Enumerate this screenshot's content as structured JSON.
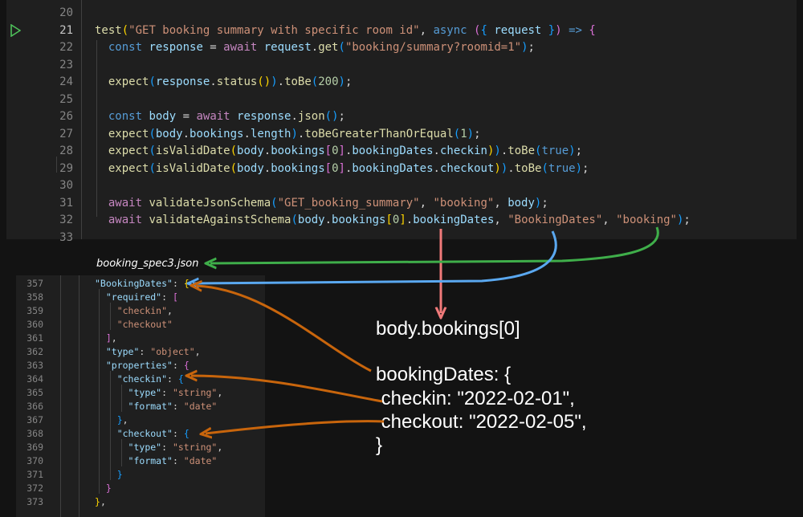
{
  "top_editor": {
    "lines": [
      {
        "n": "20",
        "tokens": []
      },
      {
        "n": "21",
        "tokens": [
          [
            "fn",
            "test"
          ],
          [
            "br1",
            "("
          ],
          [
            "str",
            "\"GET booking summary with specific room id\""
          ],
          [
            "pun",
            ", "
          ],
          [
            "kw",
            "async"
          ],
          [
            "pun",
            " "
          ],
          [
            "br2",
            "("
          ],
          [
            "br3",
            "{"
          ],
          [
            "var",
            " request "
          ],
          [
            "br3",
            "}"
          ],
          [
            "br2",
            ")"
          ],
          [
            "kw",
            " =>"
          ],
          [
            "pun",
            " "
          ],
          [
            "br2",
            "{"
          ]
        ]
      },
      {
        "n": "22",
        "tokens": [
          [
            "pun",
            "  "
          ],
          [
            "kw",
            "const"
          ],
          [
            "var",
            " response"
          ],
          [
            "pun",
            " = "
          ],
          [
            "kw2",
            "await"
          ],
          [
            "var",
            " request"
          ],
          [
            "pun",
            "."
          ],
          [
            "fn",
            "get"
          ],
          [
            "br3",
            "("
          ],
          [
            "str",
            "\"booking/summary?roomid=1\""
          ],
          [
            "br3",
            ")"
          ],
          [
            "pun",
            ";"
          ]
        ]
      },
      {
        "n": "23",
        "tokens": []
      },
      {
        "n": "24",
        "tokens": [
          [
            "pun",
            "  "
          ],
          [
            "fn",
            "expect"
          ],
          [
            "br3",
            "("
          ],
          [
            "var",
            "response"
          ],
          [
            "pun",
            "."
          ],
          [
            "fn",
            "status"
          ],
          [
            "br1",
            "()"
          ],
          [
            "br3",
            ")"
          ],
          [
            "pun",
            "."
          ],
          [
            "fn",
            "toBe"
          ],
          [
            "br3",
            "("
          ],
          [
            "num",
            "200"
          ],
          [
            "br3",
            ")"
          ],
          [
            "pun",
            ";"
          ]
        ]
      },
      {
        "n": "25",
        "tokens": []
      },
      {
        "n": "26",
        "tokens": [
          [
            "pun",
            "  "
          ],
          [
            "kw",
            "const"
          ],
          [
            "var",
            " body"
          ],
          [
            "pun",
            " = "
          ],
          [
            "kw2",
            "await"
          ],
          [
            "var",
            " response"
          ],
          [
            "pun",
            "."
          ],
          [
            "fn",
            "json"
          ],
          [
            "br3",
            "()"
          ],
          [
            "pun",
            ";"
          ]
        ]
      },
      {
        "n": "27",
        "tokens": [
          [
            "pun",
            "  "
          ],
          [
            "fn",
            "expect"
          ],
          [
            "br3",
            "("
          ],
          [
            "var",
            "body"
          ],
          [
            "pun",
            "."
          ],
          [
            "var",
            "bookings"
          ],
          [
            "pun",
            "."
          ],
          [
            "var",
            "length"
          ],
          [
            "br3",
            ")"
          ],
          [
            "pun",
            "."
          ],
          [
            "fn",
            "toBeGreaterThanOrEqual"
          ],
          [
            "br3",
            "("
          ],
          [
            "num",
            "1"
          ],
          [
            "br3",
            ")"
          ],
          [
            "pun",
            ";"
          ]
        ]
      },
      {
        "n": "28",
        "tokens": [
          [
            "pun",
            "  "
          ],
          [
            "fn",
            "expect"
          ],
          [
            "br3",
            "("
          ],
          [
            "fn",
            "isValidDate"
          ],
          [
            "br1",
            "("
          ],
          [
            "var",
            "body"
          ],
          [
            "pun",
            "."
          ],
          [
            "var",
            "bookings"
          ],
          [
            "br2",
            "["
          ],
          [
            "num",
            "0"
          ],
          [
            "br2",
            "]"
          ],
          [
            "pun",
            "."
          ],
          [
            "var",
            "bookingDates"
          ],
          [
            "pun",
            "."
          ],
          [
            "var",
            "checkin"
          ],
          [
            "br1",
            ")"
          ],
          [
            "br3",
            ")"
          ],
          [
            "pun",
            "."
          ],
          [
            "fn",
            "toBe"
          ],
          [
            "br3",
            "("
          ],
          [
            "kw",
            "true"
          ],
          [
            "br3",
            ")"
          ],
          [
            "pun",
            ";"
          ]
        ]
      },
      {
        "n": "29",
        "tokens": [
          [
            "pun",
            "  "
          ],
          [
            "fn",
            "expect"
          ],
          [
            "br3",
            "("
          ],
          [
            "fn",
            "isValidDate"
          ],
          [
            "br1",
            "("
          ],
          [
            "var",
            "body"
          ],
          [
            "pun",
            "."
          ],
          [
            "var",
            "bookings"
          ],
          [
            "br2",
            "["
          ],
          [
            "num",
            "0"
          ],
          [
            "br2",
            "]"
          ],
          [
            "pun",
            "."
          ],
          [
            "var",
            "bookingDates"
          ],
          [
            "pun",
            "."
          ],
          [
            "var",
            "checkout"
          ],
          [
            "br1",
            ")"
          ],
          [
            "br3",
            ")"
          ],
          [
            "pun",
            "."
          ],
          [
            "fn",
            "toBe"
          ],
          [
            "br3",
            "("
          ],
          [
            "kw",
            "true"
          ],
          [
            "br3",
            ")"
          ],
          [
            "pun",
            ";"
          ]
        ]
      },
      {
        "n": "30",
        "tokens": []
      },
      {
        "n": "31",
        "tokens": [
          [
            "pun",
            "  "
          ],
          [
            "kw2",
            "await"
          ],
          [
            "fn",
            " validateJsonSchema"
          ],
          [
            "br3",
            "("
          ],
          [
            "str",
            "\"GET_booking_summary\""
          ],
          [
            "pun",
            ", "
          ],
          [
            "str",
            "\"booking\""
          ],
          [
            "pun",
            ", "
          ],
          [
            "var",
            "body"
          ],
          [
            "br3",
            ")"
          ],
          [
            "pun",
            ";"
          ]
        ]
      },
      {
        "n": "32",
        "tokens": [
          [
            "pun",
            "  "
          ],
          [
            "kw2",
            "await"
          ],
          [
            "fn",
            " validateAgainstSchema"
          ],
          [
            "br3",
            "("
          ],
          [
            "var",
            "body"
          ],
          [
            "pun",
            "."
          ],
          [
            "var",
            "bookings"
          ],
          [
            "br1",
            "["
          ],
          [
            "num",
            "0"
          ],
          [
            "br1",
            "]"
          ],
          [
            "pun",
            "."
          ],
          [
            "var",
            "bookingDates"
          ],
          [
            "pun",
            ", "
          ],
          [
            "str",
            "\"BookingDates\""
          ],
          [
            "pun",
            ", "
          ],
          [
            "str",
            "\"booking\""
          ],
          [
            "br3",
            ")"
          ],
          [
            "pun",
            ";"
          ]
        ]
      },
      {
        "n": "33",
        "tokens": []
      }
    ]
  },
  "schema_file": {
    "filename": "booking_spec3.json",
    "lines": [
      {
        "n": "357",
        "tokens": [
          [
            "prop",
            "\"BookingDates\""
          ],
          [
            "pun",
            ": "
          ],
          [
            "br1",
            "{"
          ]
        ]
      },
      {
        "n": "358",
        "tokens": [
          [
            "pun",
            "  "
          ],
          [
            "prop",
            "\"required\""
          ],
          [
            "pun",
            ": "
          ],
          [
            "br2",
            "["
          ]
        ]
      },
      {
        "n": "359",
        "tokens": [
          [
            "pun",
            "    "
          ],
          [
            "str",
            "\"checkin\""
          ],
          [
            "pun",
            ","
          ]
        ]
      },
      {
        "n": "360",
        "tokens": [
          [
            "pun",
            "    "
          ],
          [
            "str",
            "\"checkout\""
          ]
        ]
      },
      {
        "n": "361",
        "tokens": [
          [
            "pun",
            "  "
          ],
          [
            "br2",
            "]"
          ],
          [
            "pun",
            ","
          ]
        ]
      },
      {
        "n": "362",
        "tokens": [
          [
            "pun",
            "  "
          ],
          [
            "prop",
            "\"type\""
          ],
          [
            "pun",
            ": "
          ],
          [
            "str",
            "\"object\""
          ],
          [
            "pun",
            ","
          ]
        ]
      },
      {
        "n": "363",
        "tokens": [
          [
            "pun",
            "  "
          ],
          [
            "prop",
            "\"properties\""
          ],
          [
            "pun",
            ": "
          ],
          [
            "br2",
            "{"
          ]
        ]
      },
      {
        "n": "364",
        "tokens": [
          [
            "pun",
            "    "
          ],
          [
            "prop",
            "\"checkin\""
          ],
          [
            "pun",
            ": "
          ],
          [
            "br3",
            "{"
          ]
        ]
      },
      {
        "n": "365",
        "tokens": [
          [
            "pun",
            "      "
          ],
          [
            "prop",
            "\"type\""
          ],
          [
            "pun",
            ": "
          ],
          [
            "str",
            "\"string\""
          ],
          [
            "pun",
            ","
          ]
        ]
      },
      {
        "n": "366",
        "tokens": [
          [
            "pun",
            "      "
          ],
          [
            "prop",
            "\"format\""
          ],
          [
            "pun",
            ": "
          ],
          [
            "str",
            "\"date\""
          ]
        ]
      },
      {
        "n": "367",
        "tokens": [
          [
            "pun",
            "    "
          ],
          [
            "br3",
            "}"
          ],
          [
            "pun",
            ","
          ]
        ]
      },
      {
        "n": "368",
        "tokens": [
          [
            "pun",
            "    "
          ],
          [
            "prop",
            "\"checkout\""
          ],
          [
            "pun",
            ": "
          ],
          [
            "br3",
            "{"
          ]
        ]
      },
      {
        "n": "369",
        "tokens": [
          [
            "pun",
            "      "
          ],
          [
            "prop",
            "\"type\""
          ],
          [
            "pun",
            ": "
          ],
          [
            "str",
            "\"string\""
          ],
          [
            "pun",
            ","
          ]
        ]
      },
      {
        "n": "370",
        "tokens": [
          [
            "pun",
            "      "
          ],
          [
            "prop",
            "\"format\""
          ],
          [
            "pun",
            ": "
          ],
          [
            "str",
            "\"date\""
          ]
        ]
      },
      {
        "n": "371",
        "tokens": [
          [
            "pun",
            "    "
          ],
          [
            "br3",
            "}"
          ]
        ]
      },
      {
        "n": "372",
        "tokens": [
          [
            "pun",
            "  "
          ],
          [
            "br2",
            "}"
          ]
        ]
      },
      {
        "n": "373",
        "tokens": [
          [
            "br1",
            "}"
          ],
          [
            "pun",
            ","
          ]
        ]
      }
    ]
  },
  "annotation": {
    "target": "body.bookings[0]",
    "object_open": "bookingDates: {",
    "checkin_line": " checkin: \"2022-02-01\",",
    "checkout_line": " checkout: \"2022-02-05\",",
    "object_close": "}"
  },
  "colors": {
    "arrow_pink": "#f07a7a",
    "arrow_blue": "#5aa8f0",
    "arrow_green": "#3fae4a",
    "arrow_orange": "#c8650c"
  }
}
